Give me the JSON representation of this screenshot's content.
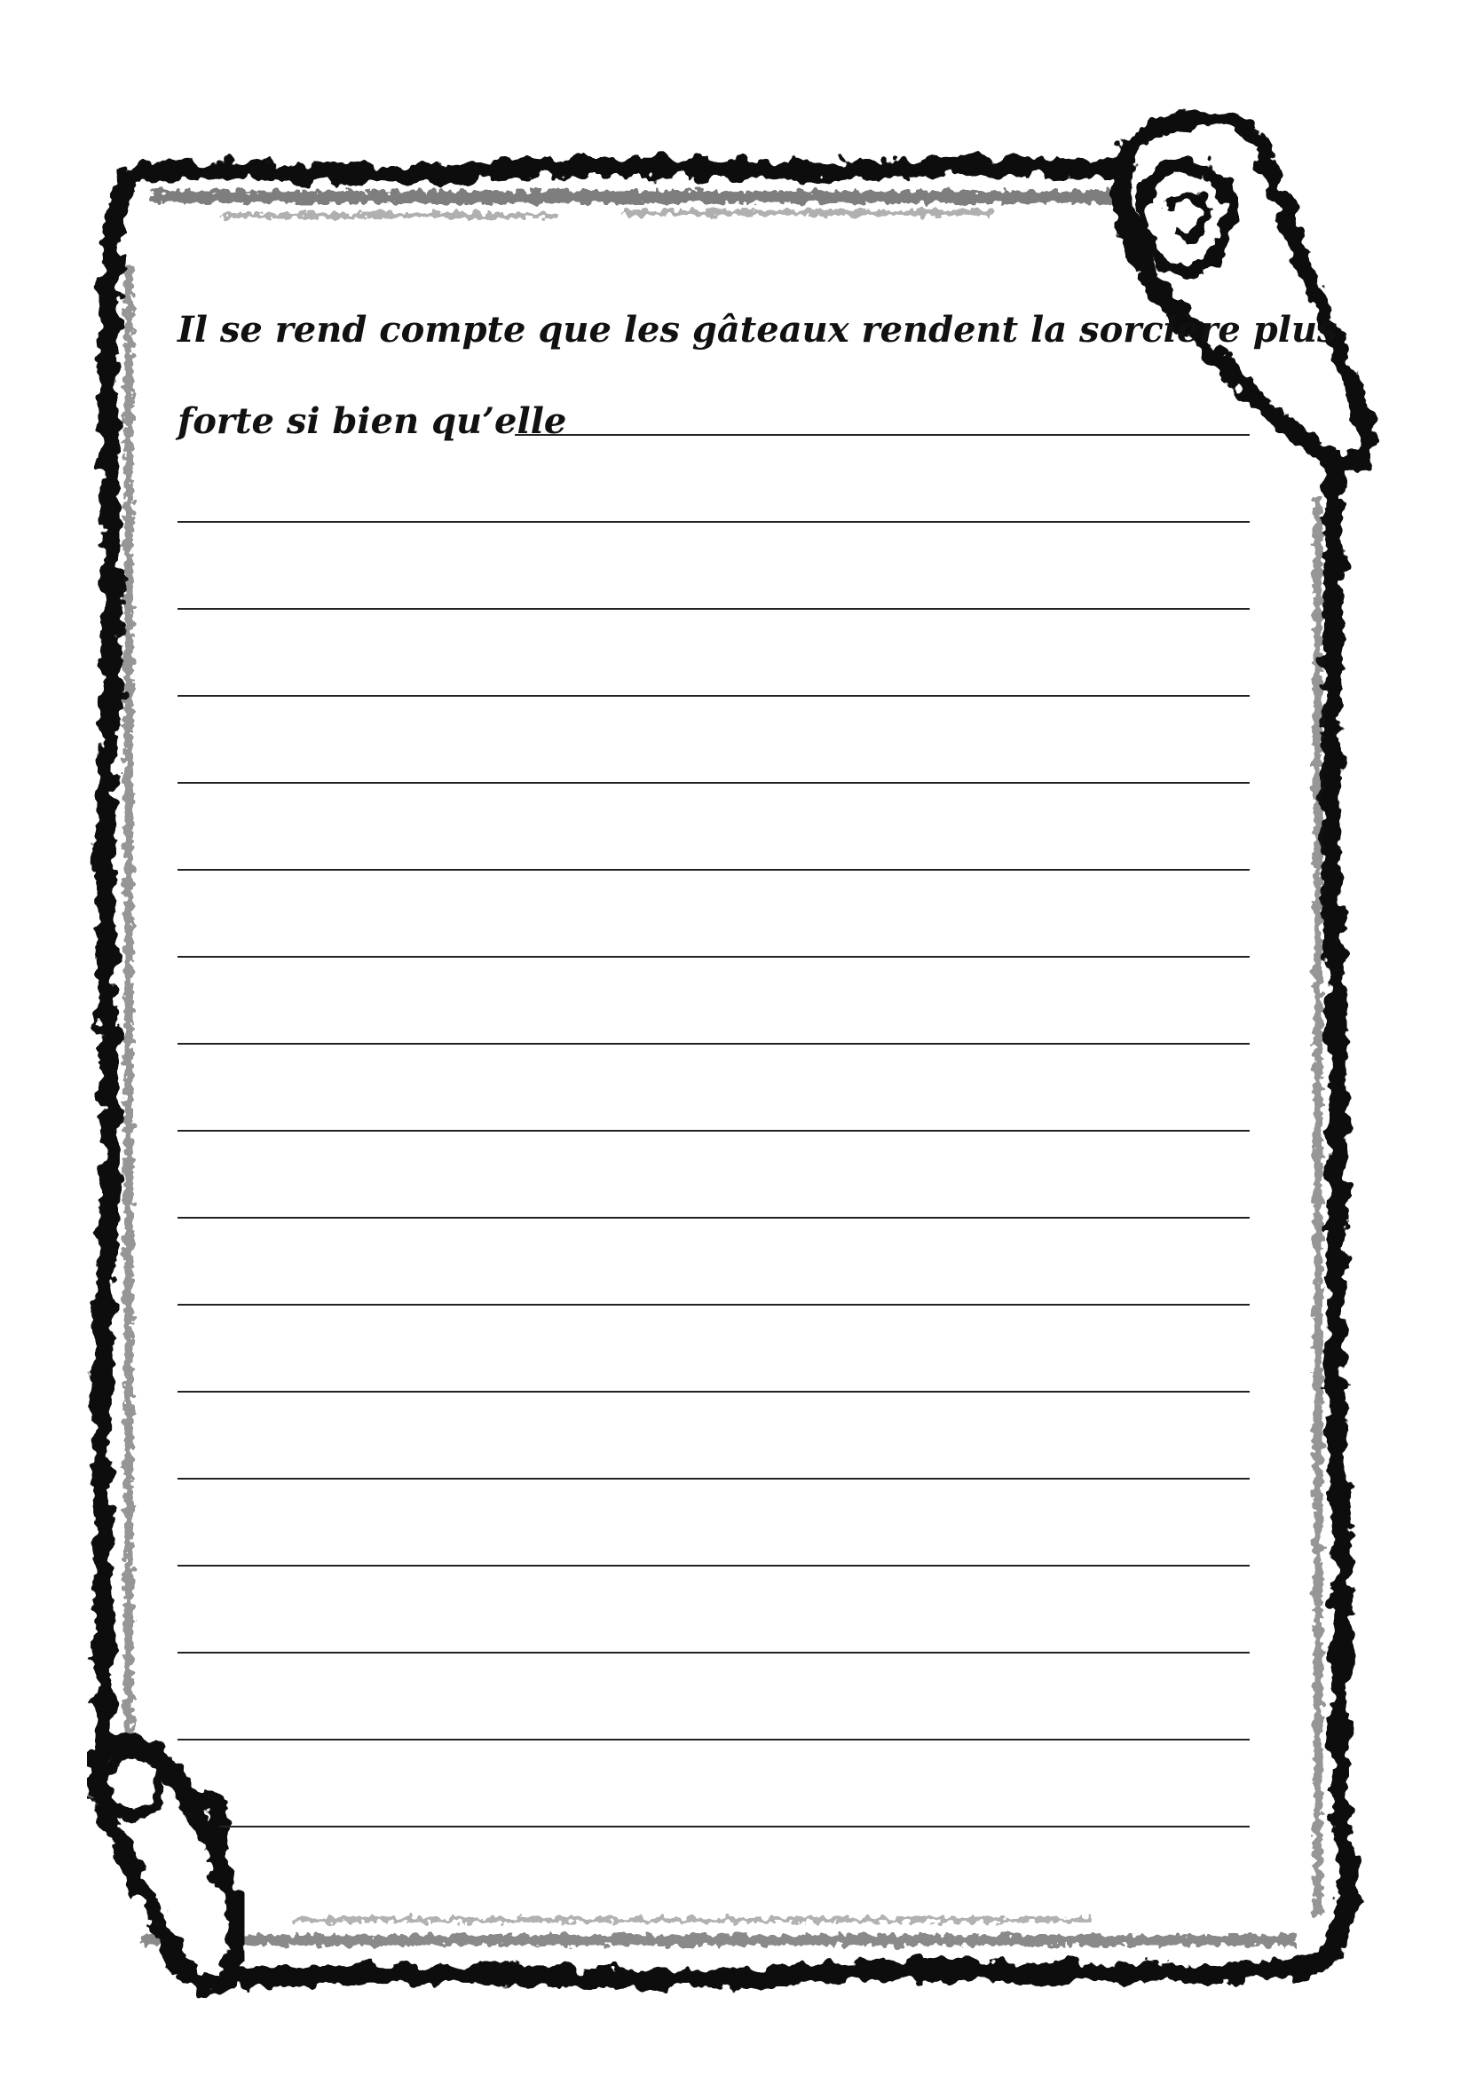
{
  "worksheet": {
    "prompt": {
      "line1": "Il se rend compte que les gâteaux rendent la sorcière plus",
      "line2": "forte si bien qu’elle"
    },
    "answer_line_count": 17
  },
  "decoration": {
    "frame": "parchment-scroll",
    "ink_color": "#111111",
    "paper_color": "#ffffff"
  }
}
